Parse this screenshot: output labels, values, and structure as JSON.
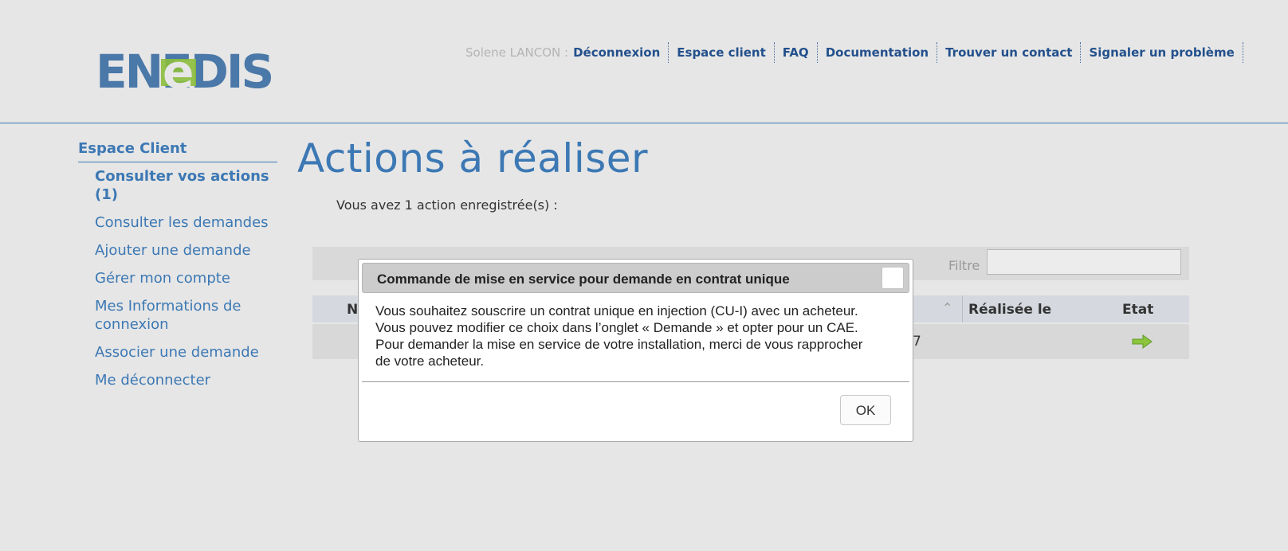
{
  "header": {
    "logo_text": "ENEDIS",
    "user_name": "Solene LANCON :",
    "links": [
      "Déconnexion",
      "Espace client",
      "FAQ",
      "Documentation",
      "Trouver un contact",
      "Signaler un problème"
    ]
  },
  "sidebar": {
    "title": "Espace Client",
    "items": [
      {
        "label": "Consulter vos actions (1)"
      },
      {
        "label": "Consulter les demandes"
      },
      {
        "label": "Ajouter une demande"
      },
      {
        "label": "Gérer mon compte"
      },
      {
        "label": "Mes Informations de connexion"
      },
      {
        "label": "Associer une demande"
      },
      {
        "label": "Me déconnecter"
      }
    ]
  },
  "main": {
    "title": "Actions à réaliser",
    "intro": "Vous avez 1 action enregistrée(s) :",
    "filter_label": "Filtre",
    "table": {
      "headers": [
        "N",
        "Réalisée le",
        "Etat"
      ],
      "row_fragment": "7"
    }
  },
  "modal": {
    "title": "Commande de mise en service pour demande en contrat unique",
    "body": [
      "Vous souhaitez souscrire un contrat unique en injection (CU-I) avec un acheteur.",
      "Vous pouvez modifier ce choix dans l’onglet « Demande » et opter pour un CAE.",
      "Pour demander la mise en service de votre installation, merci de vous rapprocher",
      "de votre acheteur."
    ],
    "ok_label": "OK"
  },
  "colors": {
    "background": "#e6e6e6",
    "brand_blue": "#3c78b4",
    "link_dark_blue": "#23508c",
    "logo_green": "#8cbe3c",
    "arrow_green": "#78b43c"
  },
  "icons": {
    "logo": "enedis-logo",
    "sort": "chevron-up-icon",
    "state": "arrow-right-icon"
  }
}
